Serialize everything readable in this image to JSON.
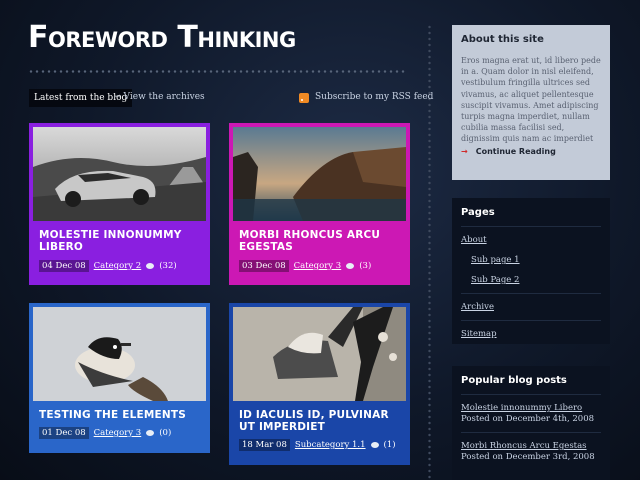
{
  "header": {
    "title": "Foreword Thinking"
  },
  "nav": {
    "latest_label": "Latest from the blog",
    "archives_link": "View the archives",
    "rss_link": "Subscribe to my RSS feed"
  },
  "posts": [
    {
      "title": "Molestie innonummy libero",
      "date": "04 Dec 08",
      "category": "Category 2",
      "comments": "(32)",
      "photo": "car-photo"
    },
    {
      "title": "Morbi rhoncus arcu egestas",
      "date": "03 Dec 08",
      "category": "Category 3",
      "comments": "(3)",
      "photo": "coast-photo"
    },
    {
      "title": "Testing the elements",
      "date": "01 Dec 08",
      "category": "Category 3",
      "comments": "(0)",
      "photo": "bird-photo"
    },
    {
      "title": "Id iaculis id, pulvinar ut imperdiet",
      "date": "18 Mar 08",
      "category": "Subcategory 1.1",
      "comments": "(1)",
      "photo": "fashion-photo"
    }
  ],
  "sidebar": {
    "about": {
      "title": "About this site",
      "text": "Eros magna erat ut, id libero pede in a. Quam dolor in nisl eleifend, vestibulum fringilla ultrices sed vivamus, ac aliquet pellentesque suscipit vivamus. Amet adipiscing turpis magna imperdiet, nullam cubilia massa facilisi sed, dignissim quis nam ac imperdiet",
      "continue": "Continue Reading"
    },
    "pages": {
      "title": "Pages",
      "items": [
        "About",
        "Sub page 1",
        "Sub Page 2",
        "Archive",
        "Sitemap"
      ]
    },
    "popular": {
      "title": "Popular blog posts",
      "items": [
        {
          "title": "Molestie innonummy Libero",
          "posted": "Posted on December 4th, 2008"
        },
        {
          "title": "Morbi Rhoncus Arcu Egestas",
          "posted": "Posted on December 3rd, 2008"
        }
      ]
    }
  },
  "colors": {
    "card_purple": "#8a1fe0",
    "card_magenta": "#cc18b4",
    "card_blue": "#2a66c9",
    "card_dark_blue": "#1a46a8",
    "about_bg": "#c3cbd8",
    "rss_orange": "#f08a24"
  }
}
